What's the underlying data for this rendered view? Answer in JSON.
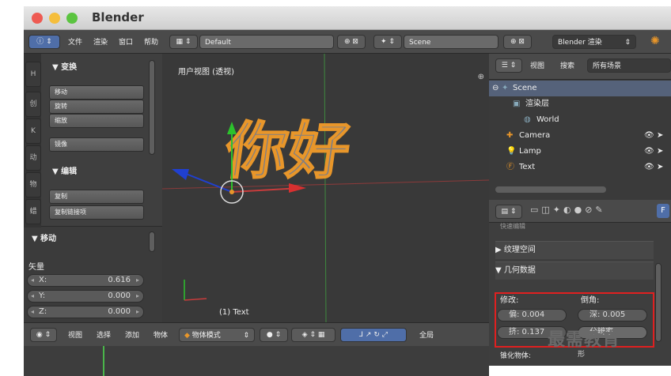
{
  "app": {
    "title": "Blender"
  },
  "colors": {
    "accent_orange": "#e8962a",
    "axis_green": "#4ab54a",
    "axis_red": "#c83c3c",
    "axis_blue": "#2040d0",
    "highlight_red": "#e02020"
  },
  "topbar": {
    "menu": [
      "文件",
      "渲染",
      "窗口",
      "帮助"
    ],
    "layout": "Default",
    "scene": "Scene",
    "engine": "Blender 渲染"
  },
  "toolshelf": {
    "transform_header": "▼ 变换",
    "transform_tools": [
      "移动",
      "旋转",
      "缩放"
    ],
    "mirror": "镜像",
    "edit_header": "▼ 编辑",
    "edit_tools": [
      "复制",
      "复制链接项"
    ],
    "move_header": "▼ 移动",
    "vector_label": "矢量",
    "vector": [
      {
        "axis": "X:",
        "value": "0.616"
      },
      {
        "axis": "Y:",
        "value": "0.000"
      },
      {
        "axis": "Z:",
        "value": "0.000"
      }
    ]
  },
  "viewport": {
    "label": "用户视图 (透视)",
    "object_label": "(1) Text",
    "text_3d": "你好"
  },
  "outliner": {
    "view": "视图",
    "search": "搜索",
    "filter": "所有场景",
    "items": [
      "Scene",
      "渲染层",
      "World",
      "Camera",
      "Lamp",
      "Text"
    ]
  },
  "properties": {
    "cut_label": "快速编辑",
    "texture_space": "▶ 纹理空间",
    "geometry": "▼ 几何数据",
    "modify_label": "修改:",
    "bevel_label": "倒角:",
    "offset": "偏: 0.004",
    "depth": "深: 0.005",
    "extrude": "挤: 0.137",
    "resolution": "分辨率",
    "taper_label": "锥化物体:",
    "hint": "形"
  },
  "bottombar": {
    "items": [
      "视图",
      "选择",
      "添加",
      "物体"
    ],
    "mode": "物体模式",
    "global": "全局"
  },
  "watermark": "最需教育"
}
